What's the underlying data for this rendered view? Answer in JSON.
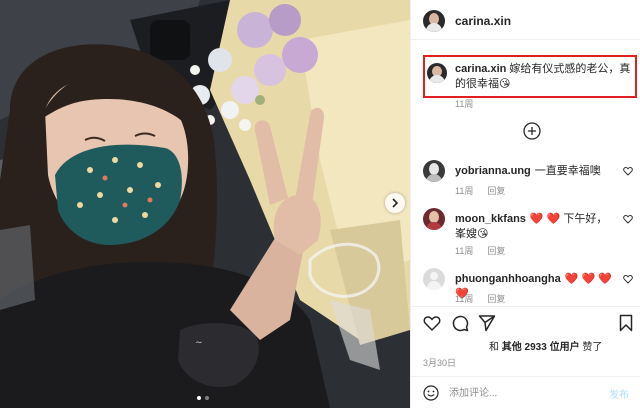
{
  "post": {
    "author": "carina.xin",
    "caption_username": "carina.xin",
    "caption_text": "嫁给有仪式感的老公，真的很幸福😘",
    "caption_time": "11周"
  },
  "comments": [
    {
      "username": "yobrianna.ung",
      "text": "一直要幸福噢",
      "time": "11周",
      "reply": "回复"
    },
    {
      "username": "moon_kkfans",
      "text": "❤️ ❤️ 下午好，峯嫂😘",
      "time": "11周",
      "reply": "回复"
    },
    {
      "username": "phuonganhhoangha",
      "text": "❤️ ❤️ ❤️ ❤️",
      "time": "11周",
      "reply": "回复"
    }
  ],
  "likes": {
    "prefix": "和",
    "bold": "其他 2933 位用户",
    "suffix": "赞了"
  },
  "date": "3月30日",
  "comment_box": {
    "placeholder": "添加评论...",
    "post_label": "发布"
  },
  "carousel": {
    "total": 2,
    "active": 1
  },
  "icons": {
    "more_comments": "plus-circle-icon",
    "like": "heart-icon",
    "comment": "comment-icon",
    "share": "send-icon",
    "save": "bookmark-icon",
    "emoji": "smiley-icon",
    "next": "chevron-right-icon"
  },
  "colors": {
    "highlight_box": "#e02020",
    "post_button": "#b2dffc"
  }
}
